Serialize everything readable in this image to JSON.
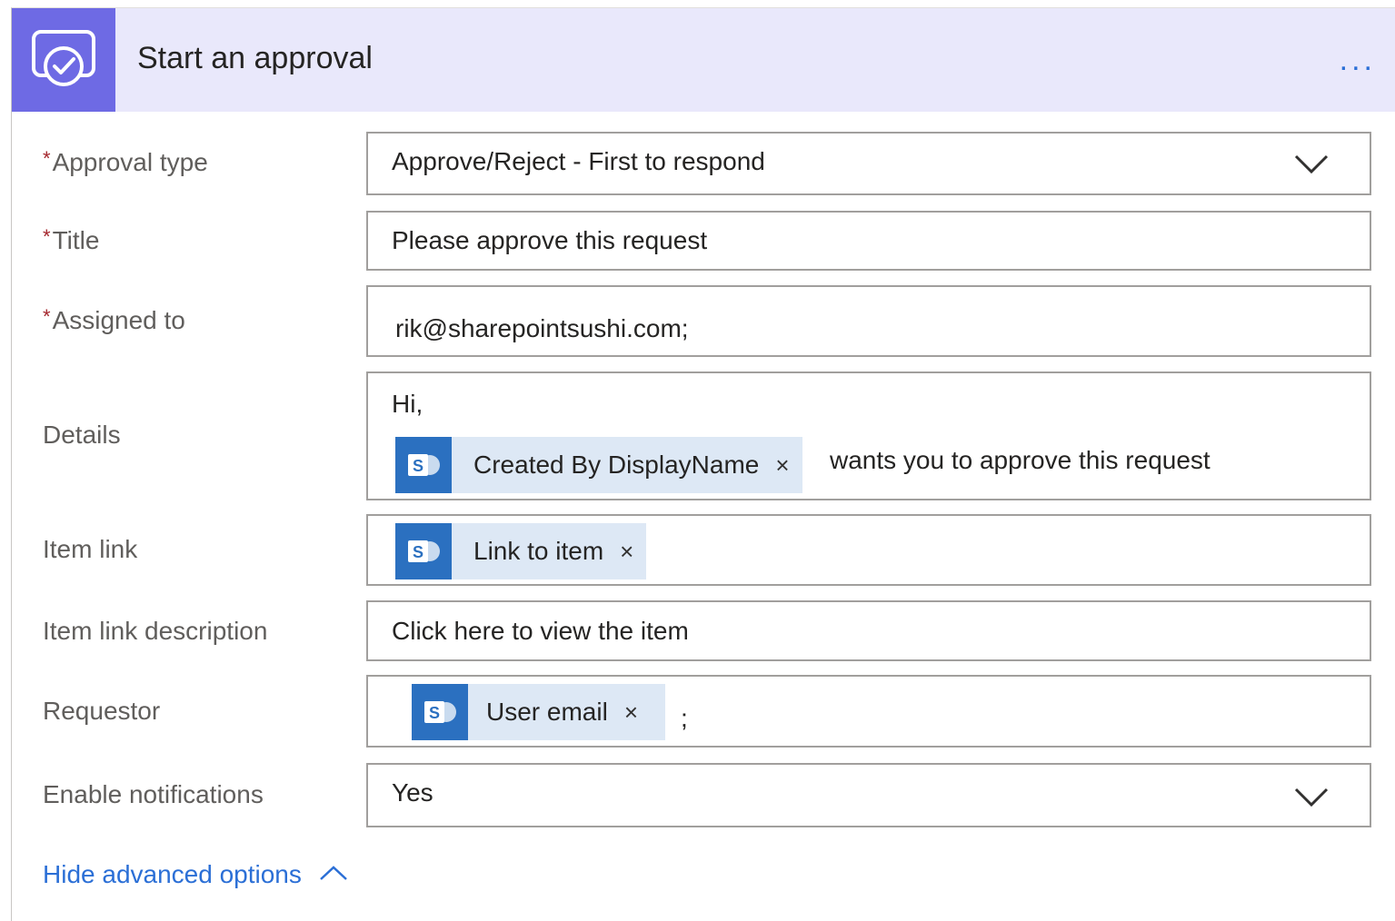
{
  "header": {
    "title": "Start an approval",
    "more": "...",
    "icon": "approval-icon",
    "accent": "#6e6ae4"
  },
  "fields": {
    "approval_type": {
      "label": "Approval type",
      "required": "*",
      "value": "Approve/Reject - First to respond"
    },
    "title": {
      "label": "Title",
      "required": "*",
      "value": "Please approve this request"
    },
    "assigned_to": {
      "label": "Assigned to",
      "required": "*",
      "value": "rik@sharepointsushi.com;"
    },
    "details": {
      "label": "Details",
      "line1": "Hi,",
      "token": "Created By DisplayName",
      "token_remove": "×",
      "trailing": "wants you to approve this request"
    },
    "item_link": {
      "label": "Item link",
      "token": "Link to item",
      "token_remove": "×"
    },
    "item_link_description": {
      "label": "Item link description",
      "value": "Click here to view the item"
    },
    "requestor": {
      "label": "Requestor",
      "token": "User email",
      "token_remove": "×",
      "trailing": ";"
    },
    "enable_notifications": {
      "label": "Enable notifications",
      "value": "Yes"
    }
  },
  "advanced": {
    "label": "Hide advanced options"
  },
  "token_icon": "sharepoint-icon"
}
